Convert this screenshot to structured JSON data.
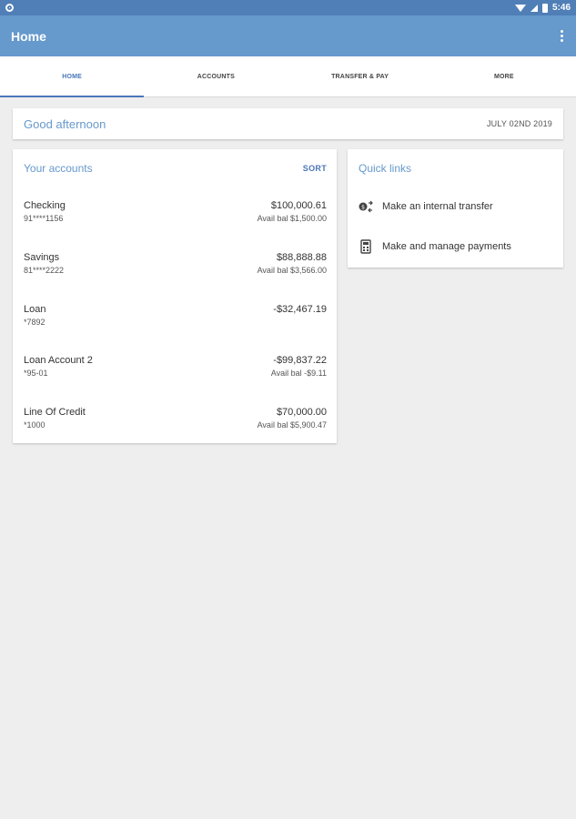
{
  "status_bar": {
    "time": "5:46"
  },
  "app_bar": {
    "title": "Home"
  },
  "tabs": [
    {
      "label": "HOME",
      "active": true
    },
    {
      "label": "ACCOUNTS",
      "active": false
    },
    {
      "label": "TRANSFER & PAY",
      "active": false
    },
    {
      "label": "MORE",
      "active": false
    }
  ],
  "greeting": {
    "text": "Good afternoon",
    "date": "JULY 02ND 2019"
  },
  "accounts": {
    "title": "Your accounts",
    "sort_label": "SORT",
    "items": [
      {
        "name": "Checking",
        "number": "91****1156",
        "balance": "$100,000.61",
        "avail": "Avail bal $1,500.00"
      },
      {
        "name": "Savings",
        "number": "81****2222",
        "balance": "$88,888.88",
        "avail": "Avail bal $3,566.00"
      },
      {
        "name": "Loan",
        "number": "*7892",
        "balance": "-$32,467.19",
        "avail": ""
      },
      {
        "name": "Loan Account 2",
        "number": "*95-01",
        "balance": "-$99,837.22",
        "avail": "Avail bal -$9.11"
      },
      {
        "name": "Line Of Credit",
        "number": "*1000",
        "balance": "$70,000.00",
        "avail": "Avail bal $5,900.47"
      }
    ]
  },
  "quick_links": {
    "title": "Quick links",
    "items": [
      {
        "label": "Make an internal transfer",
        "icon": "transfer-icon"
      },
      {
        "label": "Make and manage payments",
        "icon": "payments-icon"
      }
    ]
  },
  "colors": {
    "primary": "#6699cc",
    "status_bar": "#4f7fb6",
    "accent": "#4a76b8",
    "background": "#eeeeee"
  }
}
